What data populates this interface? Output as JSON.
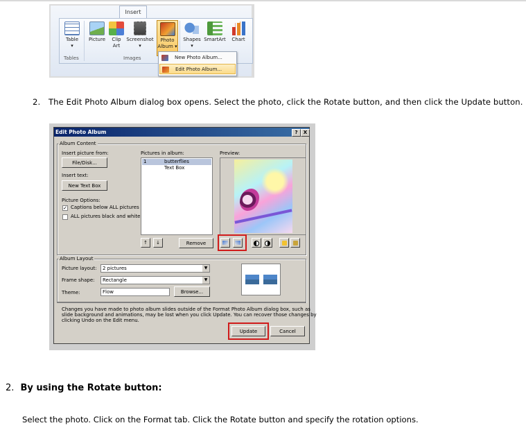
{
  "ribbon": {
    "tab": "Insert",
    "buttons": [
      {
        "label": "Table",
        "sub": "▾",
        "icon": "table-icon"
      },
      {
        "label": "Picture",
        "icon": "picture-icon"
      },
      {
        "label": "Clip",
        "sub": "Art",
        "icon": "clip-art-icon"
      },
      {
        "label": "Screenshot",
        "sub": "▾",
        "icon": "screenshot-icon"
      },
      {
        "label": "Photo",
        "sub": "Album ▾",
        "icon": "photo-album-icon"
      },
      {
        "label": "Shapes",
        "sub": "▾",
        "icon": "shapes-icon"
      },
      {
        "label": "SmartArt",
        "icon": "smartart-icon"
      },
      {
        "label": "Chart",
        "icon": "chart-icon"
      }
    ],
    "groups": {
      "tables": "Tables",
      "images": "Images"
    },
    "menu": [
      "New Photo Album...",
      "Edit Photo Album..."
    ]
  },
  "step_1": {
    "number": "2.",
    "text": "The Edit Photo Album dialog box opens. Select the photo, click the Rotate button, and then click the Update button."
  },
  "dialog": {
    "title": "Edit Photo Album",
    "help": "?",
    "close": "X",
    "album_content": "Album Content",
    "insert_picture_from": "Insert picture from:",
    "file_disk": "File/Disk...",
    "insert_text": "Insert text:",
    "new_text_box": "New Text Box",
    "picture_options": "Picture Options:",
    "captions_below": "Captions below ALL pictures",
    "all_bw": "ALL pictures black and white",
    "pictures_in_album": "Pictures in album:",
    "list": [
      {
        "num": "1",
        "name": "butterflies"
      },
      {
        "num": "",
        "name": "Text Box"
      }
    ],
    "preview": "Preview:",
    "move_up": "↑",
    "move_down": "↓",
    "remove": "Remove",
    "album_layout": "Album Layout",
    "picture_layout_label": "Picture layout:",
    "picture_layout_value": "2 pictures",
    "frame_shape_label": "Frame shape:",
    "frame_shape_value": "Rectangle",
    "theme_label": "Theme:",
    "theme_value": "Flow",
    "browse": "Browse...",
    "note_1": "Changes you have made to photo album slides outside of the Format Photo Album dialog box, such as",
    "note_2": "slide background and animations, may be lost when you click Update. You can recover those changes by",
    "note_3": "clicking Undo on the Edit menu.",
    "update": "Update",
    "cancel": "Cancel"
  },
  "step_2": {
    "number": "2.",
    "text": "By using the Rotate button:"
  },
  "paragraph": "Select the photo. Click on the Format tab. Click the Rotate button and specify the rotation options."
}
